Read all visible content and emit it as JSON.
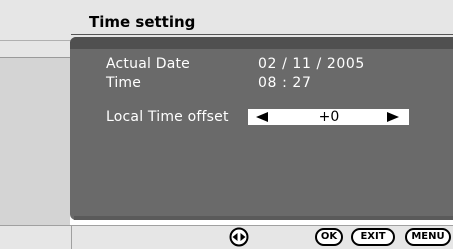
{
  "header": {
    "title": "Time setting"
  },
  "settings": {
    "actual_date_label": "Actual Date",
    "actual_date_value": "02 / 11 / 2005",
    "time_label": "Time",
    "time_value": "08 : 27",
    "local_time_offset_label": "Local Time offset",
    "local_time_offset_value": "+0"
  },
  "footer": {
    "ok_label": "OK",
    "exit_label": "EXIT",
    "menu_label": "MENU"
  },
  "icons": {
    "decrease": "left-arrow-icon",
    "increase": "right-arrow-icon",
    "navigate": "left-right-nav-icon"
  },
  "colors": {
    "panel": "#6a6a6a",
    "panel_header": "#505050",
    "chrome": "#e6e6e6",
    "text": "#ffffff",
    "field": "#ffffff"
  }
}
